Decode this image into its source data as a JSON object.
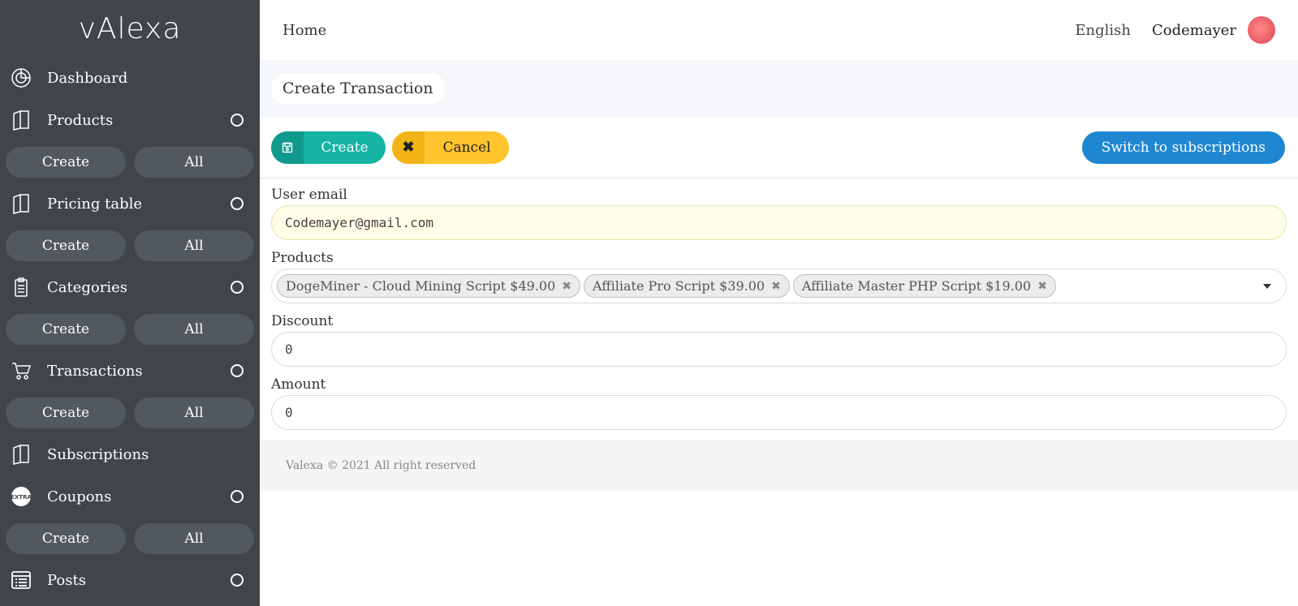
{
  "app": {
    "logo": "vAlexa"
  },
  "sidebar": {
    "items": [
      {
        "label": "Dashboard"
      },
      {
        "label": "Products"
      },
      {
        "label": "Pricing table"
      },
      {
        "label": "Categories"
      },
      {
        "label": "Transactions"
      },
      {
        "label": "Subscriptions"
      },
      {
        "label": "Coupons"
      },
      {
        "label": "Posts"
      }
    ],
    "sub": {
      "create": "Create",
      "all": "All"
    }
  },
  "topbar": {
    "home": "Home",
    "language": "English",
    "user": "Codemayer"
  },
  "breadcrumb": {
    "title": "Create Transaction"
  },
  "actions": {
    "create": "Create",
    "cancel": "Cancel",
    "switch": "Switch to subscriptions"
  },
  "form": {
    "email_label": "User email",
    "email_value": "Codemayer@gmail.com",
    "products_label": "Products",
    "products": [
      "DogeMiner - Cloud Mining Script $49.00",
      "Affiliate Pro Script $39.00",
      "Affiliate Master PHP Script $19.00"
    ],
    "tag_remove": "✖",
    "discount_label": "Discount",
    "discount_value": "0",
    "amount_label": "Amount",
    "amount_value": "0"
  },
  "footer": {
    "text": "Valexa © 2021 All right reserved"
  },
  "colors": {
    "sidebar": "#3f4549",
    "teal": "#14b3a4",
    "yellow": "#ffc42e",
    "blue": "#1f86d2"
  }
}
